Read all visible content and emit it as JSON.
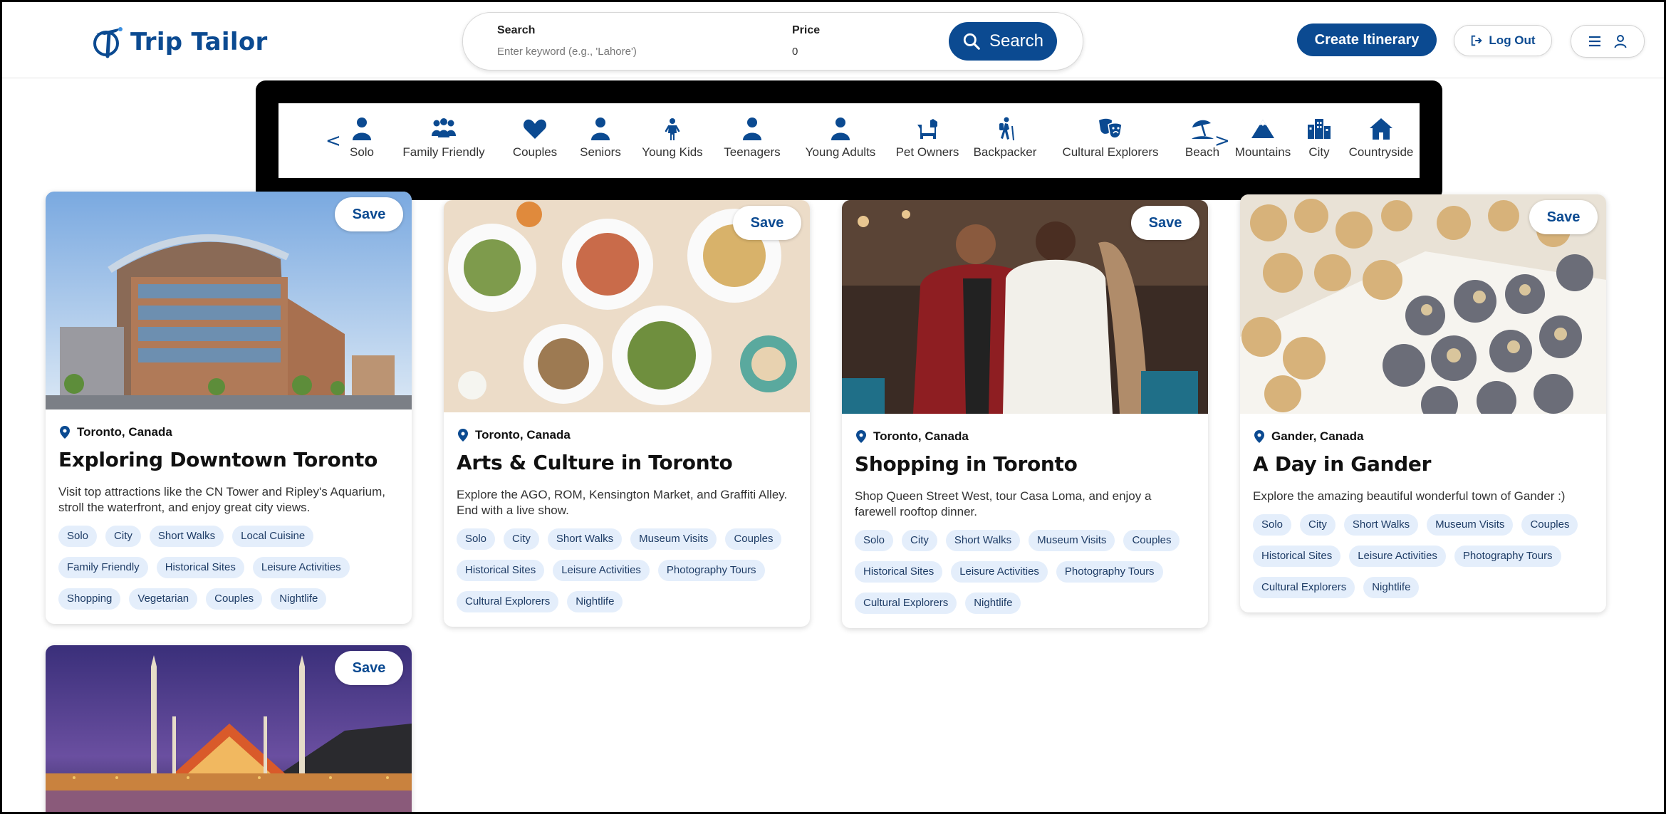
{
  "header": {
    "logo_text": "Trip Tailor",
    "search": {
      "search_label": "Search",
      "search_placeholder": "Enter keyword (e.g., 'Lahore')",
      "price_label": "Price",
      "price_value": "0",
      "button_label": "Search"
    },
    "create_itinerary_label": "Create Itinerary",
    "logout_label": "Log Out"
  },
  "categories": {
    "prev_arrow": "<",
    "next_arrow": ">",
    "items": [
      {
        "label": "Solo",
        "icon": "person-icon"
      },
      {
        "label": "Family Friendly",
        "icon": "family-icon"
      },
      {
        "label": "Couples",
        "icon": "heart-icon"
      },
      {
        "label": "Seniors",
        "icon": "person-icon"
      },
      {
        "label": "Young Kids",
        "icon": "child-icon"
      },
      {
        "label": "Teenagers",
        "icon": "person-icon"
      },
      {
        "label": "Young Adults",
        "icon": "person-icon"
      },
      {
        "label": "Pet Owners",
        "icon": "dog-icon"
      },
      {
        "label": "Backpacker",
        "icon": "hiker-icon"
      },
      {
        "label": "Cultural Explorers",
        "icon": "theater-masks-icon"
      },
      {
        "label": "Beach",
        "icon": "umbrella-beach-icon"
      },
      {
        "label": "Mountains",
        "icon": "mountain-icon"
      },
      {
        "label": "City",
        "icon": "city-icon"
      },
      {
        "label": "Countryside",
        "icon": "house-icon"
      }
    ]
  },
  "cards": [
    {
      "save_label": "Save",
      "location": "Toronto, Canada",
      "title": "Exploring Downtown Toronto",
      "description": "Visit top attractions like the CN Tower and Ripley's Aquarium, stroll the waterfront, and enjoy great city views.",
      "tags": [
        "Solo",
        "City",
        "Short Walks",
        "Local Cuisine",
        "Family Friendly",
        "Historical Sites",
        "Leisure Activities",
        "Shopping",
        "Vegetarian",
        "Couples",
        "Nightlife"
      ]
    },
    {
      "save_label": "Save",
      "location": "Toronto, Canada",
      "title": "Arts & Culture in Toronto",
      "description": "Explore the AGO, ROM, Kensington Market, and Graffiti Alley. End with a live show.",
      "tags": [
        "Solo",
        "City",
        "Short Walks",
        "Museum Visits",
        "Couples",
        "Historical Sites",
        "Leisure Activities",
        "Photography Tours",
        "Cultural Explorers",
        "Nightlife"
      ]
    },
    {
      "save_label": "Save",
      "location": "Toronto, Canada",
      "title": "Shopping in Toronto",
      "description": "Shop Queen Street West, tour Casa Loma, and enjoy a farewell rooftop dinner.",
      "tags": [
        "Solo",
        "City",
        "Short Walks",
        "Museum Visits",
        "Couples",
        "Historical Sites",
        "Leisure Activities",
        "Photography Tours",
        "Cultural Explorers",
        "Nightlife"
      ]
    },
    {
      "save_label": "Save",
      "location": "Gander, Canada",
      "title": "A Day in Gander",
      "description": "Explore the amazing beautiful wonderful town of Gander :)",
      "tags": [
        "Solo",
        "City",
        "Short Walks",
        "Museum Visits",
        "Couples",
        "Historical Sites",
        "Leisure Activities",
        "Photography Tours",
        "Cultural Explorers",
        "Nightlife"
      ]
    },
    {
      "save_label": "Save"
    }
  ],
  "colors": {
    "brand": "#0b4a91",
    "tag_bg": "#e4eefb",
    "tag_text": "#1e3c66"
  }
}
